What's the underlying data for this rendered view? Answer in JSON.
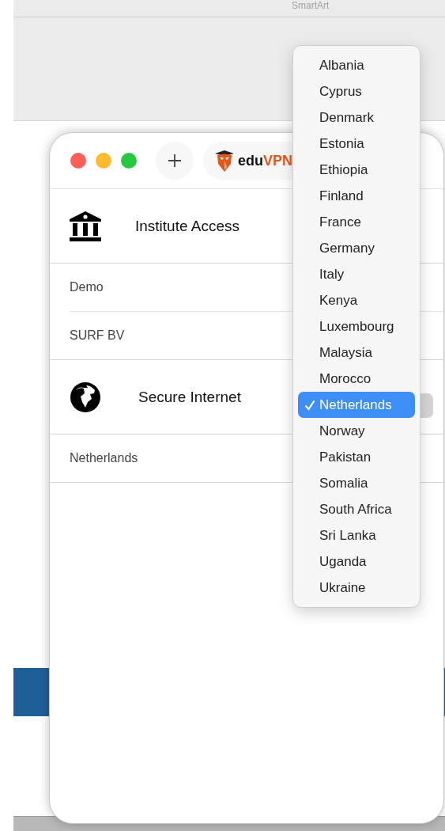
{
  "background_app": {
    "ribbon_label": "SmartArt"
  },
  "window": {
    "logo": {
      "prefix": "edu",
      "suffix": "VPN"
    },
    "sections": [
      {
        "kind": "institute",
        "title": "Institute Access",
        "items": [
          {
            "label": "Demo"
          },
          {
            "label": "SURF BV"
          }
        ]
      },
      {
        "kind": "secure",
        "title": "Secure Internet",
        "items": [
          {
            "label": "Netherlands"
          }
        ]
      }
    ]
  },
  "country_menu": {
    "items": [
      {
        "label": "Albania",
        "selected": false
      },
      {
        "label": "Cyprus",
        "selected": false
      },
      {
        "label": "Denmark",
        "selected": false
      },
      {
        "label": "Estonia",
        "selected": false
      },
      {
        "label": "Ethiopia",
        "selected": false
      },
      {
        "label": "Finland",
        "selected": false
      },
      {
        "label": "France",
        "selected": false
      },
      {
        "label": "Germany",
        "selected": false
      },
      {
        "label": "Italy",
        "selected": false
      },
      {
        "label": "Kenya",
        "selected": false
      },
      {
        "label": "Luxembourg",
        "selected": false
      },
      {
        "label": "Malaysia",
        "selected": false
      },
      {
        "label": "Morocco",
        "selected": false
      },
      {
        "label": "Netherlands",
        "selected": true
      },
      {
        "label": "Norway",
        "selected": false
      },
      {
        "label": "Pakistan",
        "selected": false
      },
      {
        "label": "Somalia",
        "selected": false
      },
      {
        "label": "South Africa",
        "selected": false
      },
      {
        "label": "Sri Lanka",
        "selected": false
      },
      {
        "label": "Uganda",
        "selected": false
      },
      {
        "label": "Ukraine",
        "selected": false
      }
    ]
  }
}
